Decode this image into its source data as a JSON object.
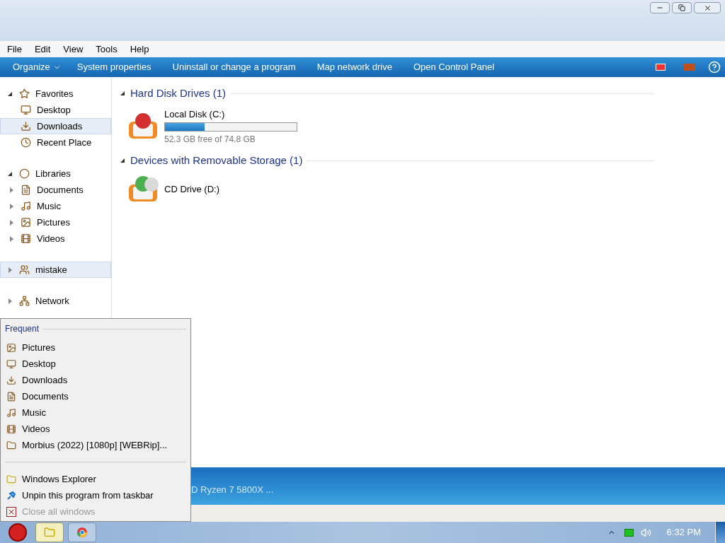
{
  "menu": [
    "File",
    "Edit",
    "View",
    "Tools",
    "Help"
  ],
  "toolbar": {
    "organize": "Organize",
    "commands": [
      "System properties",
      "Uninstall or change a program",
      "Map network drive",
      "Open Control Panel"
    ]
  },
  "nav": [
    {
      "label": "Favorites",
      "kind": "favorites",
      "expanded": true,
      "selected": false,
      "children": [
        {
          "label": "Desktop",
          "selected": false
        },
        {
          "label": "Downloads",
          "selected": true
        },
        {
          "label": "Recent Place",
          "selected": false
        }
      ]
    },
    {
      "label": "Libraries",
      "kind": "libraries",
      "expanded": true,
      "selected": false,
      "children": [
        {
          "label": "Documents",
          "expanded": false,
          "selected": false
        },
        {
          "label": "Music",
          "expanded": false,
          "selected": false
        },
        {
          "label": "Pictures",
          "expanded": false,
          "selected": false
        },
        {
          "label": "Videos",
          "expanded": false,
          "selected": false
        }
      ]
    },
    {
      "label": "mistake",
      "kind": "homegroup",
      "expanded": false,
      "selected": true
    },
    {
      "label": "Network",
      "kind": "network",
      "expanded": false,
      "selected": false
    }
  ],
  "groups": [
    {
      "title": "Hard Disk Drives (1)",
      "expanded": true,
      "items": [
        {
          "kind": "disk",
          "name": "Local Disk (C:)",
          "level": 0.3,
          "free": "52.3 GB free of 74.8 GB"
        }
      ]
    },
    {
      "title": "Devices with Removable Storage (1)",
      "expanded": true,
      "items": [
        {
          "kind": "cd",
          "name": "CD Drive (D:)"
        }
      ]
    }
  ],
  "details": {
    "text": "D Ryzen 7 5800X ..."
  },
  "jump_list": {
    "heading": "Frequent",
    "frequent": [
      "Pictures",
      "Desktop",
      "Downloads",
      "Documents",
      "Music",
      "Videos",
      "Morbius (2022) [1080p] [WEBRip]..."
    ],
    "tasks": [
      {
        "label": "Windows Explorer",
        "disabled": false
      },
      {
        "label": "Unpin this program from taskbar",
        "disabled": false
      },
      {
        "label": "Close all windows",
        "disabled": true
      }
    ]
  },
  "taskbar": {
    "apps": [
      {
        "kind": "explorer",
        "selected": true
      },
      {
        "kind": "chrome",
        "selected": false
      }
    ],
    "clock": "6:32 PM"
  }
}
